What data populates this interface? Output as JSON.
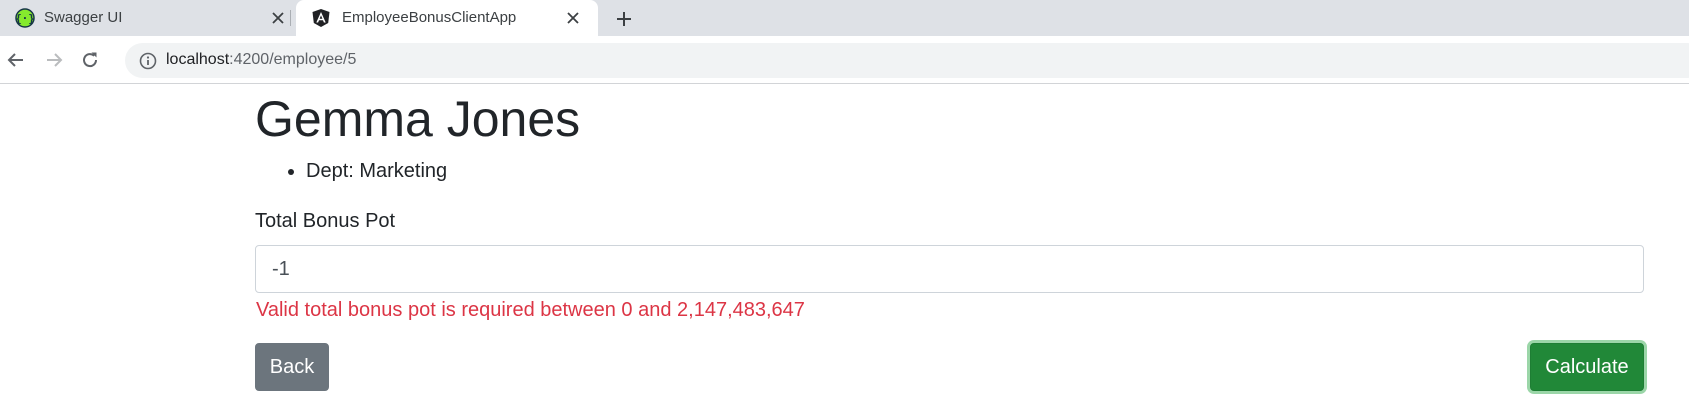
{
  "browser": {
    "tabs": [
      {
        "title": "Swagger UI",
        "icon": "swagger-icon",
        "active": false
      },
      {
        "title": "EmployeeBonusClientApp",
        "icon": "angular-icon",
        "active": true
      }
    ],
    "address": {
      "host": "localhost",
      "path": ":4200/employee/5"
    }
  },
  "page": {
    "employee_name": "Gemma Jones",
    "details": [
      "Dept: Marketing"
    ],
    "bonus_field": {
      "label": "Total Bonus Pot",
      "value": "-1",
      "error": "Valid total bonus pot is required between 0 and 2,147,483,647"
    },
    "buttons": {
      "back": "Back",
      "calculate": "Calculate"
    }
  },
  "colors": {
    "error": "#dc3545",
    "calculate": "#218838",
    "back": "#6c757d"
  }
}
